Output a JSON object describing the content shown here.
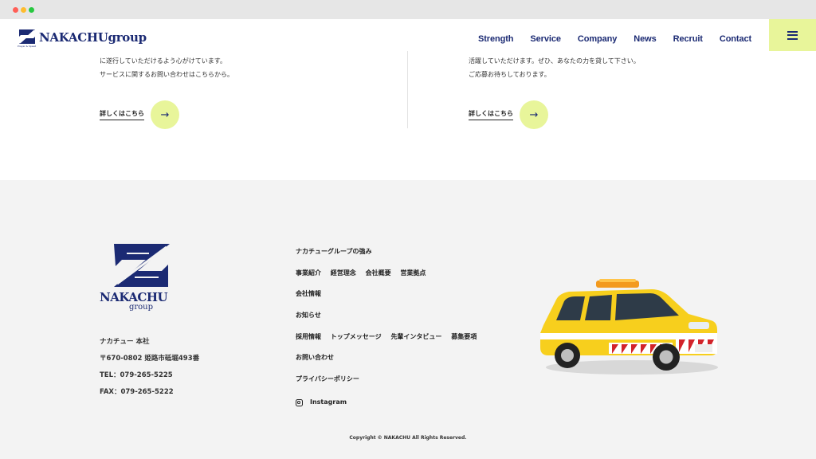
{
  "header": {
    "logo": {
      "text_main": "NAKACHU",
      "text_group": "group",
      "sub": "Prayer & Speed"
    },
    "nav": [
      {
        "label": "Strength"
      },
      {
        "label": "Service"
      },
      {
        "label": "Company"
      },
      {
        "label": "News"
      },
      {
        "label": "Recruit"
      },
      {
        "label": "Contact"
      }
    ],
    "menu_icon": "hamburger-icon"
  },
  "sections": {
    "left": {
      "lines": [
        "に遂行していただけるよう心がけています。",
        "サービスに関するお問い合わせはこちらから。"
      ],
      "more_label": "詳しくはこちら",
      "arrow": "→"
    },
    "right": {
      "lines": [
        "活躍していただけます。ぜひ、あなたの力を貸して下さい。",
        "ご応募お待ちしております。"
      ],
      "more_label": "詳しくはこちら",
      "arrow": "→"
    }
  },
  "footer": {
    "logo": {
      "name": "NAKACHU",
      "group": "group"
    },
    "address": {
      "company": "ナカチュー 本社",
      "postal": "〒670-0802 姫路市砥堀493番",
      "tel": "TEL：079-265-5225",
      "fax": "FAX：079-265-5222"
    },
    "links": {
      "strength": "ナカチューグループの強み",
      "service": [
        "事業紹介",
        "経営理念",
        "会社概要",
        "営業拠点"
      ],
      "company": "会社情報",
      "news": "お知らせ",
      "recruit": [
        "採用情報",
        "トップメッセージ",
        "先輩インタビュー",
        "募集要項"
      ],
      "contact": "お問い合わせ",
      "privacy": "プライバシーポリシー",
      "instagram": "Instagram"
    },
    "copyright": "Copyright © NAKACHU All Rights Reserved."
  },
  "colors": {
    "brand_navy": "#1b2a73",
    "accent_lime": "#e8f59a",
    "footer_bg": "#f3f3f3"
  }
}
